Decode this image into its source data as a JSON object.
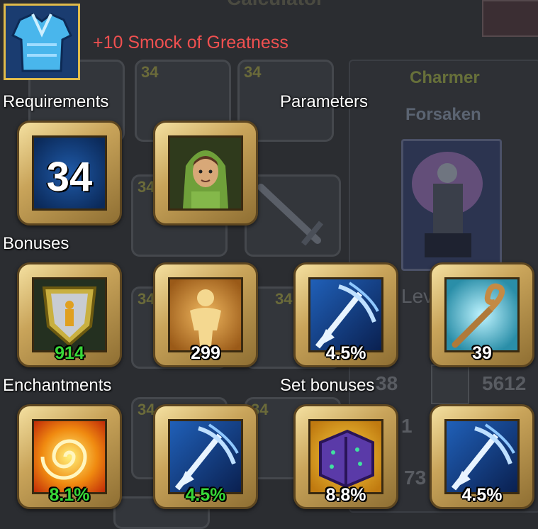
{
  "background": {
    "title": "Calculator",
    "slot_levels": [
      "34",
      "34",
      "34",
      "34",
      "34",
      "34",
      "1",
      "34",
      "34",
      "34"
    ],
    "class_name": "Charmer",
    "faction": "Forsaken",
    "level_label": "Lev",
    "stat_values": [
      "38",
      "5612",
      "1",
      "73"
    ]
  },
  "item": {
    "name": "+10 Smock of Greatness",
    "icon": "blue-armor-icon"
  },
  "sections": {
    "requirements": "Requirements",
    "parameters": "Parameters",
    "bonuses": "Bonuses",
    "enchantments": "Enchantments",
    "set_bonuses": "Set bonuses"
  },
  "requirements": {
    "level": "34",
    "class_icon": "hooded-charmer-portrait"
  },
  "bonuses": [
    {
      "icon": "shield-defense-icon",
      "value": "914",
      "color": "#38d838"
    },
    {
      "icon": "body-health-icon",
      "value": "299",
      "color": "#ffffff"
    },
    {
      "icon": "arrow-speed-icon",
      "value": "4.5%",
      "color": "#ffffff"
    },
    {
      "icon": "staff-magic-icon",
      "value": "39",
      "color": "#ffffff"
    }
  ],
  "enchantments": [
    {
      "icon": "fire-swirl-icon",
      "value": "8.1%",
      "color": "#38d838"
    },
    {
      "icon": "arrow-speed-icon",
      "value": "4.5%",
      "color": "#38d838"
    }
  ],
  "set_bonuses": [
    {
      "icon": "spellbook-icon",
      "value": "8.8%",
      "color": "#ffffff"
    },
    {
      "icon": "arrow-speed-icon",
      "value": "4.5%",
      "color": "#ffffff"
    }
  ]
}
